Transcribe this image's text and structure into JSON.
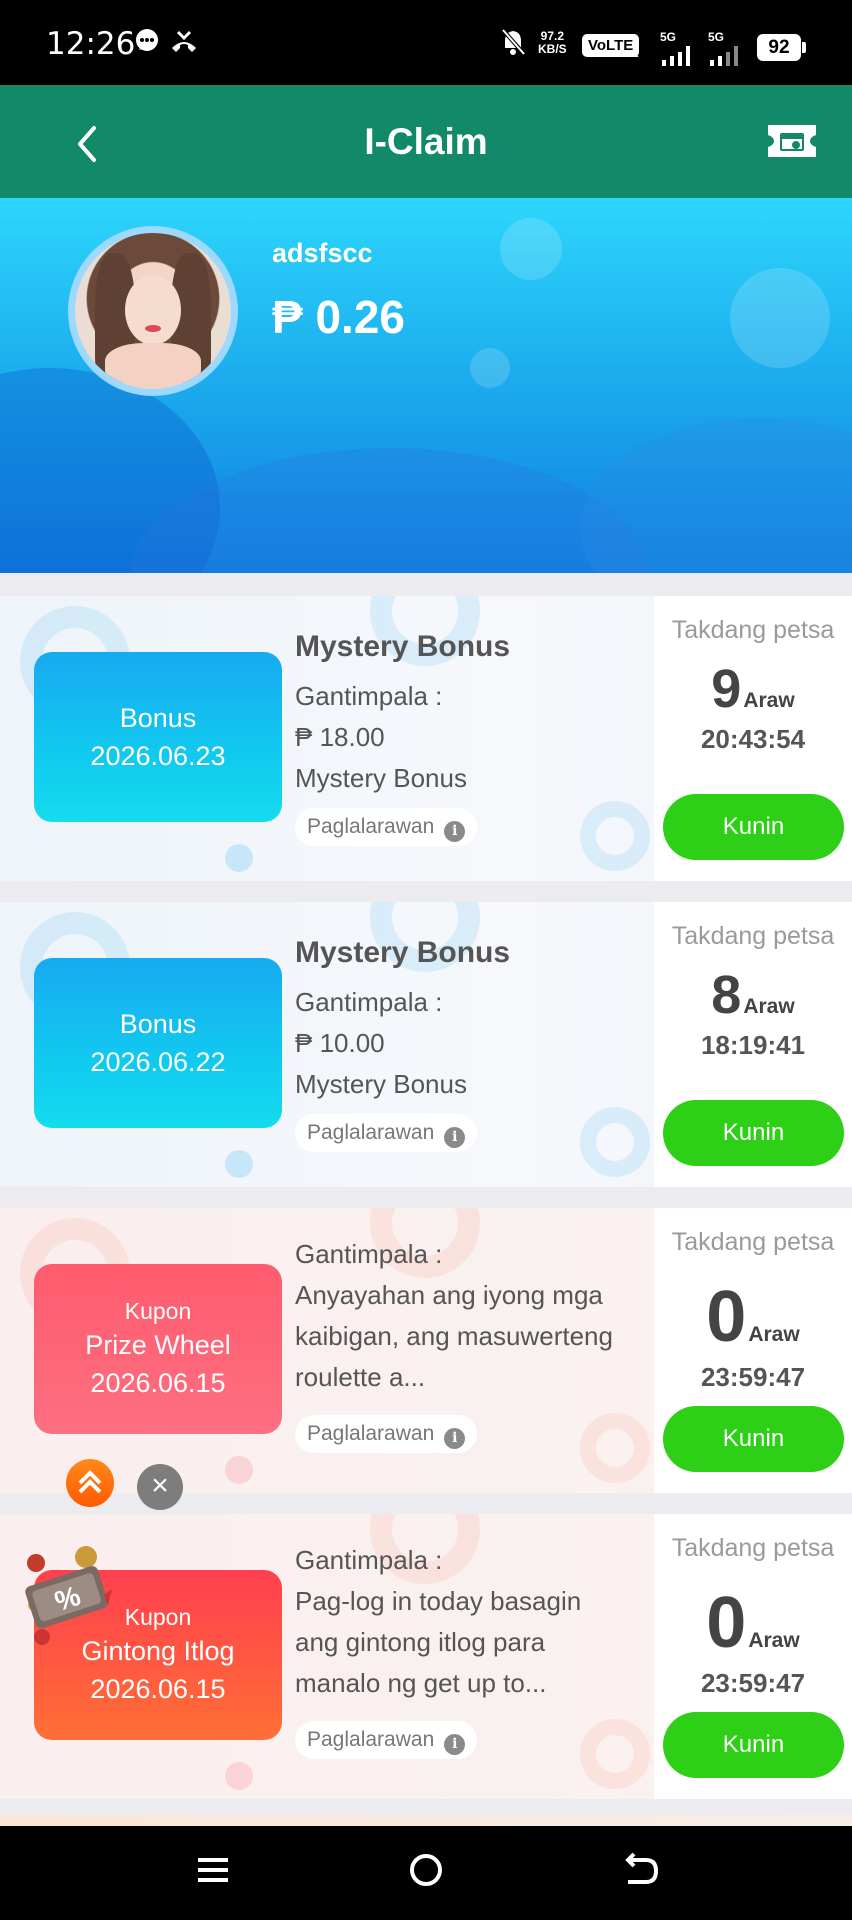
{
  "status": {
    "time": "12:26",
    "net_speed_top": "97.2",
    "net_speed_unit": "KB/S",
    "volte": "VoLTE",
    "sim1": "1",
    "sim2": "2",
    "sig1": "5G",
    "sig2": "5G",
    "battery": "92"
  },
  "header": {
    "title": "I-Claim",
    "back_icon": "chevron-left-icon",
    "right_icon": "ticket-calendar-icon"
  },
  "profile": {
    "username": "adsfscc",
    "balance": "₱ 0.26"
  },
  "cards": [
    {
      "tile_type": "",
      "tile_name": "Bonus",
      "tile_date": "2026.06.23",
      "title": "Mystery Bonus",
      "reward_label": "Gantimpala :",
      "reward_value": "₱ 18.00",
      "reward_desc": "Mystery Bonus",
      "tag": "Paglalarawan",
      "deadline_label": "Takdang petsa",
      "days": "9",
      "days_unit": "Araw",
      "countdown": "20:43:54",
      "claim": "Kunin",
      "color": "cyan"
    },
    {
      "tile_type": "",
      "tile_name": "Bonus",
      "tile_date": "2026.06.22",
      "title": "Mystery Bonus",
      "reward_label": "Gantimpala :",
      "reward_value": "₱ 10.00",
      "reward_desc": "Mystery Bonus",
      "tag": "Paglalarawan",
      "deadline_label": "Takdang petsa",
      "days": "8",
      "days_unit": "Araw",
      "countdown": "18:19:41",
      "claim": "Kunin",
      "color": "cyan"
    },
    {
      "tile_type": "Kupon",
      "tile_name": "Prize Wheel",
      "tile_date": "2026.06.15",
      "reward_label": "Gantimpala :",
      "reward_desc": "Anyayahan ang iyong mga kaibigan, ang masuwerteng roulette a...",
      "tag": "Paglalarawan",
      "deadline_label": "Takdang petsa",
      "days": "0",
      "days_unit": "Araw",
      "countdown": "23:59:47",
      "claim": "Kunin",
      "color": "pink"
    },
    {
      "tile_type": "Kupon",
      "tile_name": "Gintong Itlog",
      "tile_date": "2026.06.15",
      "reward_label": "Gantimpala :",
      "reward_desc": "Pag-log in today basagin ang gintong itlog para manalo ng get up to...",
      "tag": "Paglalarawan",
      "deadline_label": "Takdang petsa",
      "days": "0",
      "days_unit": "Araw",
      "countdown": "23:59:47",
      "claim": "Kunin",
      "color": "orange"
    }
  ],
  "floating": {
    "scroll_top_icon": "double-chevron-up-icon",
    "close_icon": "close-icon",
    "promo_icon": "percent-coupon-icon"
  },
  "colors": {
    "header_bg": "#128a69",
    "hero_top": "#2dd6fb",
    "claim_button": "#2ecf17"
  }
}
